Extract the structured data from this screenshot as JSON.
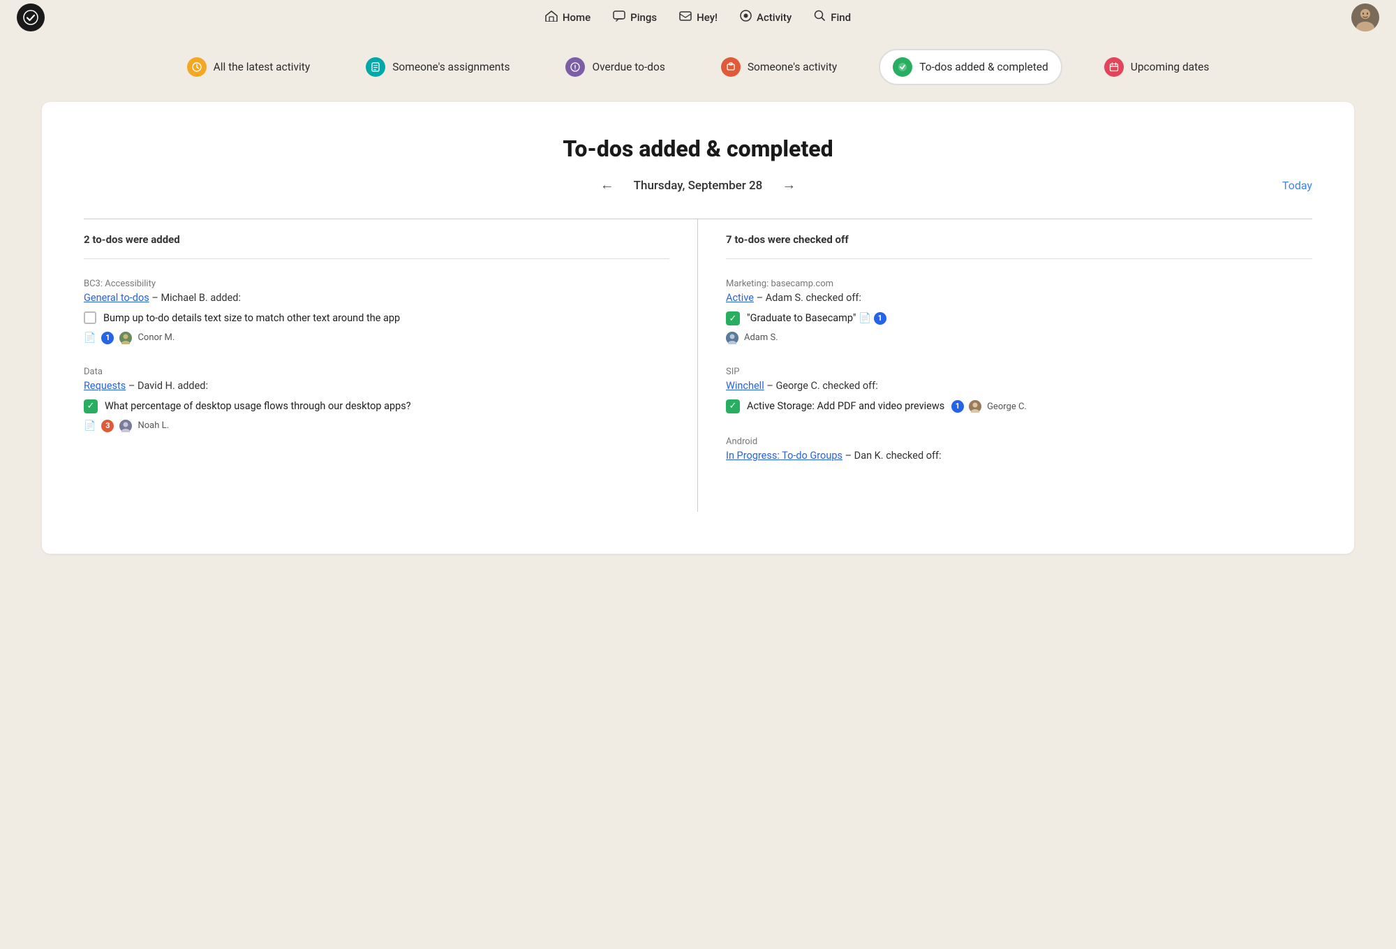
{
  "nav": {
    "logo_symbol": "✓",
    "items": [
      {
        "id": "home",
        "label": "Home",
        "icon": "⛰"
      },
      {
        "id": "pings",
        "label": "Pings",
        "icon": "💬"
      },
      {
        "id": "hey",
        "label": "Hey!",
        "icon": "🖥"
      },
      {
        "id": "activity",
        "label": "Activity",
        "icon": "⬤"
      },
      {
        "id": "find",
        "label": "Find",
        "icon": "🔍"
      }
    ]
  },
  "filter_bar": {
    "items": [
      {
        "id": "latest",
        "label": "All the latest activity",
        "icon_color": "icon-yellow",
        "icon": "🕐",
        "active": false
      },
      {
        "id": "assignments",
        "label": "Someone's assignments",
        "icon_color": "icon-teal",
        "icon": "📋",
        "active": false
      },
      {
        "id": "overdue",
        "label": "Overdue to-dos",
        "icon_color": "icon-purple",
        "icon": "🔔",
        "active": false
      },
      {
        "id": "someones",
        "label": "Someone's activity",
        "icon_color": "icon-red",
        "icon": "💼",
        "active": false
      },
      {
        "id": "todos",
        "label": "To-dos added & completed",
        "icon_color": "icon-green",
        "icon": "✓",
        "active": true
      },
      {
        "id": "upcoming",
        "label": "Upcoming dates",
        "icon_color": "icon-pink",
        "icon": "📅",
        "active": false
      }
    ]
  },
  "main": {
    "title": "To-dos added & completed",
    "date_label": "Thursday, September 28",
    "today_label": "Today",
    "left_col_header": "2 to-dos were added",
    "right_col_header": "7 to-dos were checked off",
    "left_items": [
      {
        "project": "BC3: Accessibility",
        "list_link": "General to-dos",
        "action": "– Michael B. added:",
        "checked": false,
        "todo_text": "Bump up to-do details text size to match other text around the app",
        "doc_icon": "📄",
        "count": "1",
        "person_name": "Conor M."
      },
      {
        "project": "Data",
        "list_link": "Requests",
        "action": "– David H. added:",
        "checked": true,
        "todo_text": "What percentage of desktop usage flows through our desktop apps?",
        "doc_icon": "📄",
        "count": "3",
        "count_color": "orange",
        "person_name": "Noah L."
      }
    ],
    "right_items": [
      {
        "project": "Marketing: basecamp.com",
        "list_link": "Active",
        "action": "– Adam S. checked off:",
        "checked": true,
        "todo_text": "\"Graduate to Basecamp\"",
        "doc_icon": "📄",
        "count": "1",
        "person_name": "Adam S."
      },
      {
        "project": "SIP",
        "list_link": "Winchell",
        "action": "– George C. checked off:",
        "checked": true,
        "todo_text": "Active Storage: Add PDF and video previews",
        "doc_icon": "",
        "count": "1",
        "person_name": "George C."
      },
      {
        "project": "Android",
        "list_link": "In Progress: To-do Groups",
        "action": "– Dan K. checked off:",
        "checked": false,
        "todo_text": "",
        "doc_icon": "",
        "count": "",
        "person_name": ""
      }
    ]
  }
}
